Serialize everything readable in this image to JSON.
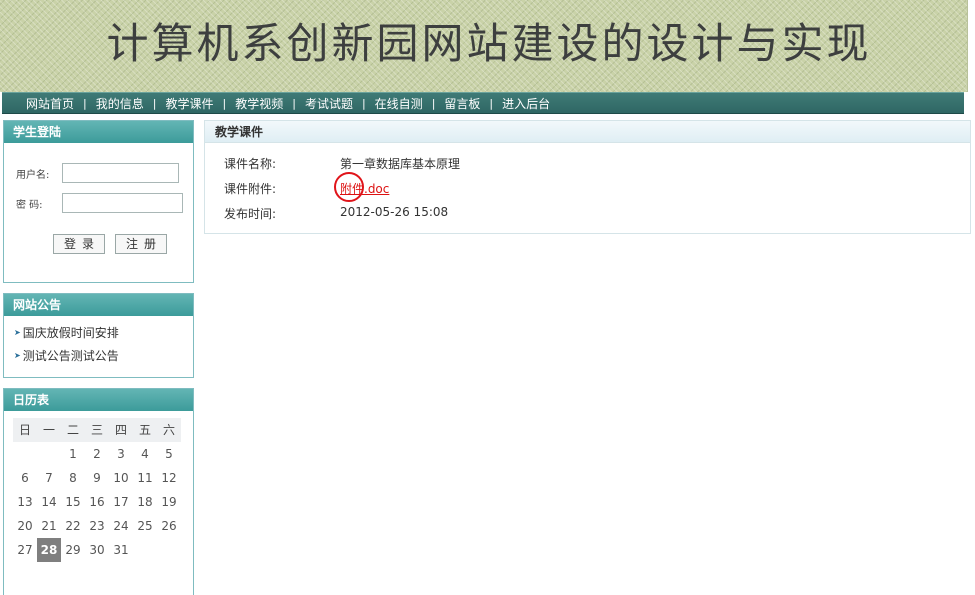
{
  "header": {
    "title": "计算机系创新园网站建设的设计与实现"
  },
  "nav": {
    "items": [
      "网站首页",
      "我的信息",
      "教学课件",
      "教学视频",
      "考试试题",
      "在线自测",
      "留言板",
      "进入后台"
    ],
    "separator": "|"
  },
  "login": {
    "title": "学生登陆",
    "username_label": "用户名:",
    "password_label": "密  码:",
    "username_value": "",
    "password_value": "",
    "login_button": "登录",
    "register_button": "注册"
  },
  "notices": {
    "title": "网站公告",
    "items": [
      "国庆放假时间安排",
      "测试公告测试公告"
    ]
  },
  "calendar": {
    "title": "日历表",
    "weekdays": [
      "日",
      "一",
      "二",
      "三",
      "四",
      "五",
      "六"
    ],
    "days": [
      [
        "",
        "",
        "1",
        "2",
        "3",
        "4",
        "5"
      ],
      [
        "6",
        "7",
        "8",
        "9",
        "10",
        "11",
        "12"
      ],
      [
        "13",
        "14",
        "15",
        "16",
        "17",
        "18",
        "19"
      ],
      [
        "20",
        "21",
        "22",
        "23",
        "24",
        "25",
        "26"
      ],
      [
        "27",
        "28",
        "29",
        "30",
        "31",
        "",
        ""
      ]
    ],
    "today": "28"
  },
  "main": {
    "title": "教学课件",
    "name_label": "课件名称:",
    "name_value": "第一章数据库基本原理",
    "attachment_label": "课件附件:",
    "attachment_value": "附件.doc",
    "date_label": "发布时间:",
    "date_value": "2012-05-26 15:08"
  },
  "colors": {
    "nav_bg": "#2f6764",
    "panel_header_bg": "#3c9b9a",
    "link_red": "#d11111",
    "banner_bg": "#c9d2a8"
  }
}
